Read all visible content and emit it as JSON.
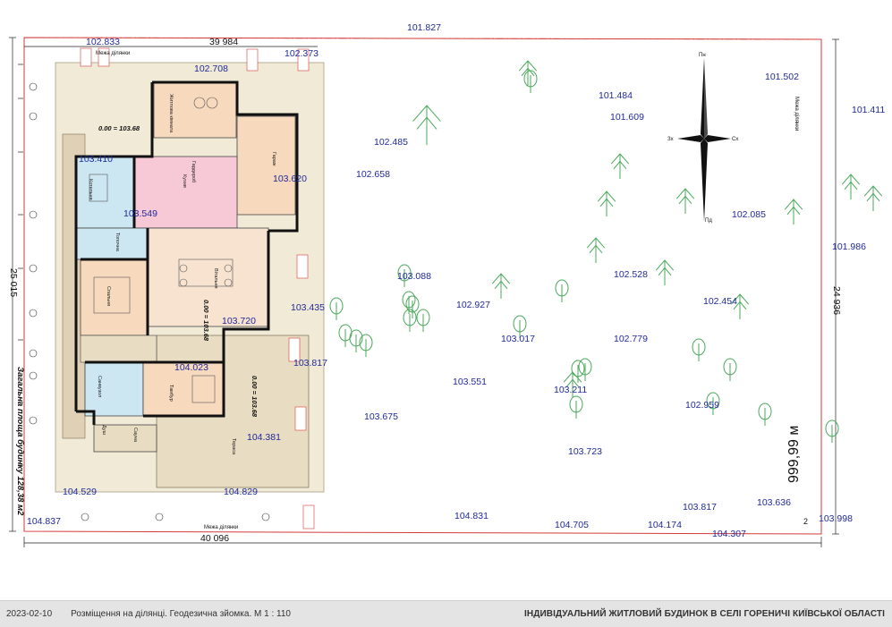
{
  "drawing": {
    "top_dimension": "39 984",
    "bottom_dimension": "40 096",
    "left_dimension": "25 015",
    "right_dimension": "24 936",
    "area_label": "999,99 м",
    "area_superscript": "2",
    "building_area_label": "Загальна площа будинку 128,38 м2",
    "plot_boundary_label": "Межа ділянки",
    "compass": {
      "north": "Пн",
      "south": "Пд",
      "east": "Сх",
      "west": "Зх"
    },
    "building_levels": [
      "0.00 = 103.68",
      "0.00 = 103.68",
      "0.00 = 103.68"
    ],
    "rooms": [
      "Житлова кімната",
      "Гараж",
      "Вітальня",
      "Спальня",
      "Санвузол",
      "Кухня",
      "Тераса",
      "Котельня",
      "Душ",
      "Сауна",
      "Гардероб",
      "Топочна",
      "Тамбур"
    ],
    "elevation_labels": [
      "101.827",
      "102.833",
      "102.373",
      "102.708",
      "101.502",
      "101.484",
      "101.609",
      "101.411",
      "102.485",
      "102.658",
      "102.085",
      "101.986",
      "103.088",
      "102.528",
      "102.927",
      "102.454",
      "103.017",
      "102.779",
      "103.551",
      "103.211",
      "103.675",
      "102.959",
      "103.723",
      "103.435",
      "103.817",
      "103.720",
      "104.023",
      "104.381",
      "104.829",
      "104.529",
      "104.837",
      "104.831",
      "104.705",
      "104.174",
      "104.307",
      "103.817",
      "103.636",
      "103.998",
      "103.620",
      "103.549",
      "103.410"
    ]
  },
  "footer": {
    "date": "2023-02-10",
    "subtitle": "Розміщення на ділянці. Геодезична зйомка. М 1 : 110",
    "title": "ІНДИВІДУАЛЬНИЙ ЖИТЛОВИЙ БУДИНОК В СЕЛІ ГОРЕНИЧІ КИЇВСЬКОЇ ОБЛАСТІ"
  }
}
